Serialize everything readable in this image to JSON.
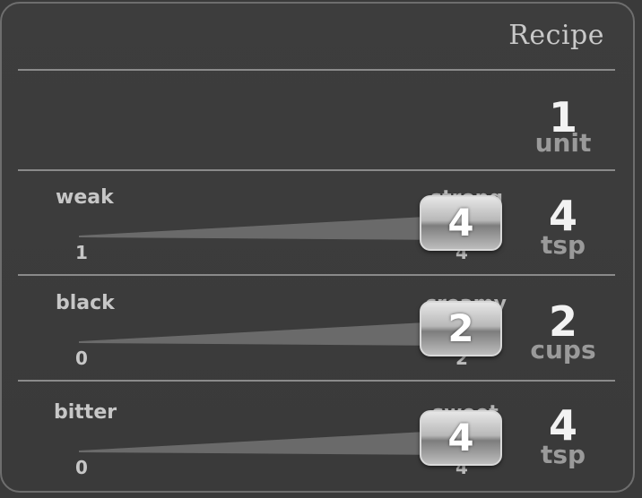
{
  "title": "Recipe",
  "servings": {
    "value": "1",
    "unit": "unit"
  },
  "sliders": [
    {
      "left_label": "weak",
      "right_label": "strong",
      "min": "1",
      "max": "4",
      "value": "4",
      "amount": "4",
      "unit": "tsp"
    },
    {
      "left_label": "black",
      "right_label": "creamy",
      "min": "0",
      "max": "2",
      "value": "2",
      "amount": "2",
      "unit": "cups"
    },
    {
      "left_label": "bitter",
      "right_label": "sweet",
      "min": "0",
      "max": "4",
      "value": "4",
      "amount": "4",
      "unit": "tsp"
    }
  ]
}
